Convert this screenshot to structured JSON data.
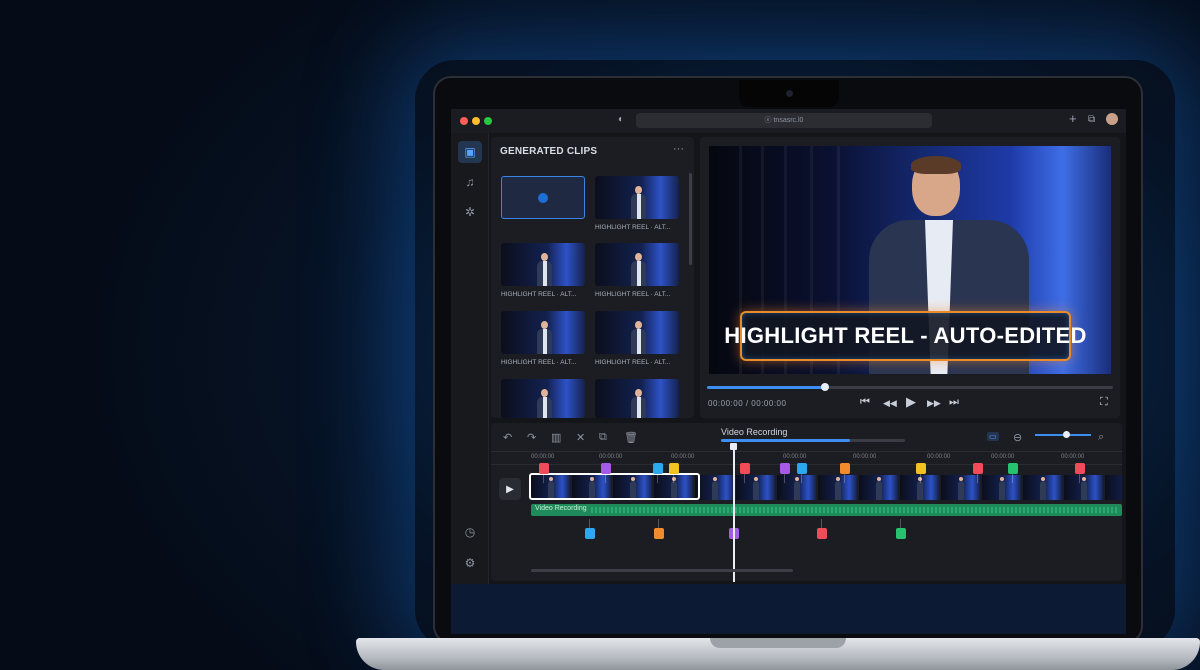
{
  "browser": {
    "address": "ⓔ tnsasrc.l0",
    "colors": {
      "close": "#ff5f57",
      "min": "#febc2e",
      "max": "#28c840"
    }
  },
  "sidebar": {
    "icons": [
      "video-icon",
      "music-icon",
      "effects-icon",
      "clock-icon",
      "settings-icon"
    ]
  },
  "clips_panel": {
    "title": "GENERATED CLIPS",
    "more": "···",
    "clips": [
      {
        "caption": ""
      },
      {
        "caption": "HIGHLIGHT REEL · ALT..."
      },
      {
        "caption": "HIGHLIGHT REEL · ALT..."
      },
      {
        "caption": "HIGHLIGHT REEL · ALT..."
      },
      {
        "caption": "HIGHLIGHT REEL · ALT..."
      },
      {
        "caption": "HIGHLIGHT REEL · ALT..."
      },
      {
        "caption": ""
      },
      {
        "caption": ""
      }
    ]
  },
  "preview": {
    "overlay_title": "HIGHLIGHT REEL - AUTO-EDITED",
    "timecode": "00:00:00 / 00:00:00",
    "progress": 0.29,
    "controls": {
      "prev": "⏮",
      "rewind": "◀◀",
      "play": "▶",
      "forward": "▶▶",
      "next": "⏭",
      "fullscreen": "⛶"
    }
  },
  "timeline": {
    "title": "Video Recording",
    "progress": 0.7,
    "ruler_labels": [
      "00:00:00",
      "00:00:00",
      "00:00:00",
      "00:00:00",
      "00:00:00",
      "00:00:00",
      "00:00:00",
      "00:00:00",
      "00:00:00"
    ],
    "audio_label": "Video Recording",
    "play": "▶",
    "zoom_level": 0.55,
    "marker_colors_top": [
      "#ef4b5b",
      "#a45ce6",
      "#2fa6f0",
      "#f3c222",
      "#ef4b5b",
      "#a45ce6",
      "#2fa6f0",
      "#f28b2b",
      "#f3c222",
      "#ef4b5b",
      "#26c270",
      "#ef4b5b"
    ],
    "marker_colors_bottom": [
      "#2fa6f0",
      "#f28b2b",
      "#a45ce6",
      "#ef4b5b",
      "#26c270"
    ],
    "tools": [
      "undo-icon",
      "redo-icon",
      "trim-icon",
      "cut-icon",
      "copy-icon",
      "delete-icon"
    ]
  }
}
